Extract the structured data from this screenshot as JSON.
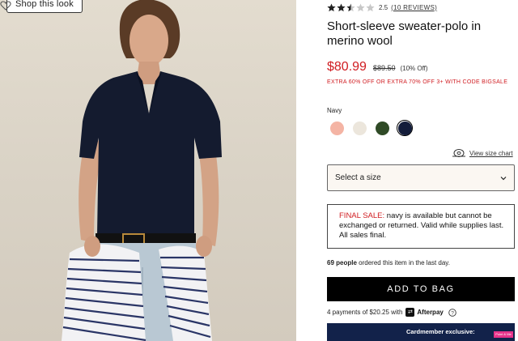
{
  "photo": {
    "shop_look_label": "Shop this look",
    "heart_icon": "heart-outline-icon"
  },
  "product": {
    "rating_value": "2.5",
    "rating_stars": 2.5,
    "reviews_label": "(10 REVIEWS)",
    "title": "Short-sleeve sweater-polo in merino wool",
    "price_now": "$80.99",
    "price_was": "$89.50",
    "price_off": "(10% Off)",
    "promo": "EXTRA 60% OFF OR EXTRA 70% OFF 3+ WITH CODE BIGSALE",
    "color_label": "Navy",
    "swatches": [
      {
        "name": "coral",
        "color": "#f4b4a4",
        "selected": false
      },
      {
        "name": "ivory",
        "color": "#ece6dc",
        "selected": false
      },
      {
        "name": "green",
        "color": "#2f4a26",
        "selected": false
      },
      {
        "name": "navy",
        "color": "#141d3a",
        "selected": true
      }
    ],
    "size_chart_label": "View size chart",
    "size_select_label": "Select a size",
    "final_sale_strong": "FINAL SALE:",
    "final_sale_text": "navy is available but cannot be exchanged or returned. Valid while supplies last. All sales final.",
    "ordered_count": "69 people",
    "ordered_text": "ordered this item in the last day.",
    "add_to_bag_label": "ADD TO BAG",
    "afterpay_text": "4 payments of $20.25 with",
    "afterpay_brand": "Afterpay",
    "card_banner_text": "Cardmember exclusive:",
    "point_tag_label": "Point & Me"
  },
  "colors": {
    "sale_red": "#d01c21",
    "button_black": "#000000",
    "banner_navy": "#12224a"
  }
}
